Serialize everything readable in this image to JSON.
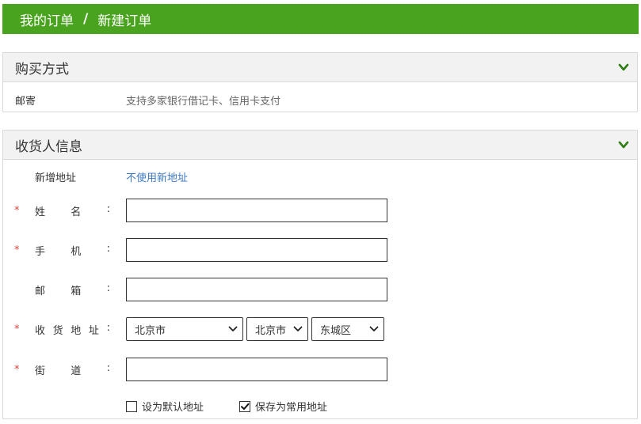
{
  "breadcrumb": {
    "parent": "我的订单",
    "separator": "/",
    "current": "新建订单"
  },
  "colors": {
    "header_bg": "#4aa31f",
    "accent": "#4aa31f",
    "required": "#e0433a",
    "link": "#3b78c4"
  },
  "payment_panel": {
    "title": "购买方式",
    "method_label": "邮寄",
    "method_desc": "支持多家银行借记卡、信用卡支付"
  },
  "receiver_panel": {
    "title": "收货人信息",
    "new_address_label": "新增地址",
    "new_address_link": "不使用新地址",
    "required_mark": "*",
    "colon": ":",
    "fields": {
      "name": {
        "chars": [
          "姓",
          "名"
        ],
        "value": ""
      },
      "phone": {
        "chars": [
          "手",
          "机"
        ],
        "value": ""
      },
      "email": {
        "chars": [
          "邮",
          "箱"
        ],
        "value": ""
      },
      "address": {
        "chars": [
          "收",
          "货",
          "地",
          "址"
        ]
      },
      "street": {
        "chars": [
          "街",
          "道"
        ],
        "value": ""
      }
    },
    "province": "北京市",
    "city": "北京市",
    "district": "东城区",
    "default_address": {
      "label": "设为默认地址",
      "checked": false
    },
    "save_common": {
      "label": "保存为常用地址",
      "checked": true
    }
  },
  "icons": {
    "collapse": "chevron-down-icon",
    "select_caret": "caret-down-icon",
    "check": "check-icon"
  }
}
